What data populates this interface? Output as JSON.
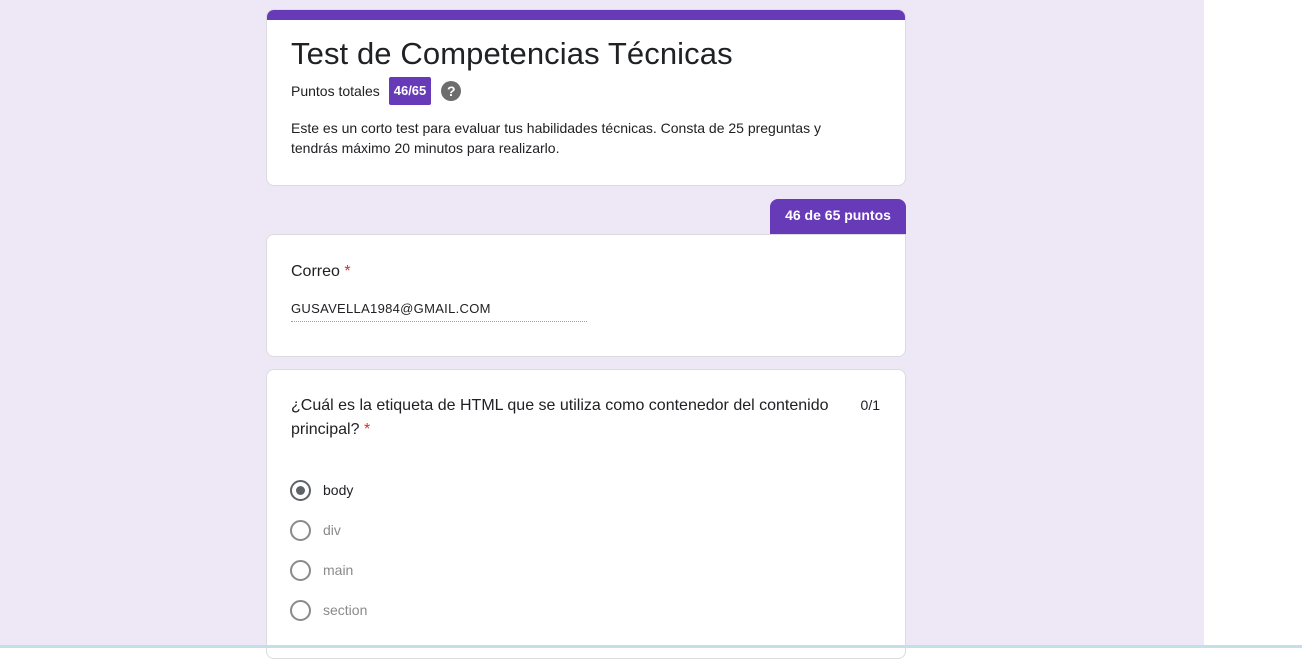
{
  "form": {
    "title": "Test de Competencias Técnicas",
    "score_label": "Puntos totales",
    "score_value": "46/65",
    "help_glyph": "?",
    "description": "Este es un corto test para evaluar tus habilidades técnicas. Consta de 25 preguntas y tendrás máximo 20 minutos para realizarlo.",
    "accent_color": "#673ab7",
    "background_color": "#ede7f6"
  },
  "points_tab": "46 de 65 puntos",
  "email_question": {
    "label": "Correo",
    "required_mark": "*",
    "value": "GUSAVELLA1984@GMAIL.COM"
  },
  "question1": {
    "text": "¿Cuál es la etiqueta de HTML que se utiliza como contenedor del contenido principal?",
    "required_mark": "*",
    "points": "0/1",
    "options": [
      {
        "label": "body",
        "selected": true
      },
      {
        "label": "div",
        "selected": false
      },
      {
        "label": "main",
        "selected": false
      },
      {
        "label": "section",
        "selected": false
      }
    ]
  }
}
